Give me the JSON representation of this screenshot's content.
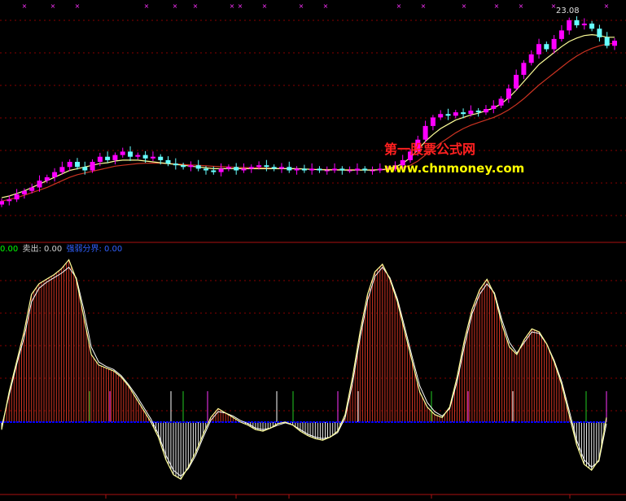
{
  "price_panel": {
    "high_label": "23.08",
    "watermark_cn": "第一股票公式网",
    "watermark_url": "www.chnmoney.com"
  },
  "indicator_panel": {
    "legend": [
      {
        "text": "0.00",
        "color": "#00ff00"
      },
      {
        "text": "卖出: 0.00",
        "color": "#d0d0d0"
      },
      {
        "text": "强弱分界: 0.00",
        "color": "#3060ff"
      }
    ]
  },
  "colors": {
    "up_candle": "#ff00ff",
    "down_candle": "#66ffff",
    "ma_fast": "#ffff99",
    "ma_slow": "#cc3322",
    "osc_line": "#ffff99",
    "osc_bars": "#cc3322",
    "zero_line": "#0000ff",
    "grid": "#880000"
  },
  "chart_data": [
    {
      "type": "candlestick",
      "title": "",
      "close": [
        12.2,
        12.3,
        12.6,
        12.8,
        13.0,
        13.4,
        13.6,
        13.9,
        14.2,
        14.5,
        14.2,
        14.0,
        14.5,
        14.8,
        14.6,
        14.9,
        15.1,
        14.8,
        14.9,
        14.7,
        14.8,
        14.6,
        14.4,
        14.3,
        14.2,
        14.3,
        14.1,
        14.0,
        13.9,
        14.1,
        14.2,
        14.0,
        14.1,
        14.2,
        14.3,
        14.2,
        14.1,
        14.2,
        14.0,
        14.1,
        14.0,
        14.1,
        14.0,
        14.0,
        14.1,
        14.0,
        14.0,
        14.1,
        14.0,
        14.0,
        14.1,
        14.1,
        14.3,
        14.6,
        15.1,
        15.8,
        16.6,
        17.1,
        17.3,
        17.2,
        17.4,
        17.3,
        17.5,
        17.4,
        17.6,
        17.8,
        18.2,
        18.8,
        19.6,
        20.3,
        20.8,
        21.4,
        21.1,
        21.7,
        22.2,
        22.8,
        22.5,
        22.6,
        22.3,
        21.8,
        21.3,
        21.6
      ],
      "ma_fast": [
        12.4,
        12.5,
        12.65,
        12.8,
        13.0,
        13.2,
        13.4,
        13.6,
        13.8,
        14.0,
        14.1,
        14.2,
        14.3,
        14.4,
        14.45,
        14.55,
        14.6,
        14.6,
        14.6,
        14.55,
        14.5,
        14.45,
        14.4,
        14.35,
        14.3,
        14.25,
        14.2,
        14.15,
        14.1,
        14.1,
        14.1,
        14.1,
        14.1,
        14.1,
        14.1,
        14.1,
        14.1,
        14.1,
        14.1,
        14.1,
        14.08,
        14.06,
        14.04,
        14.03,
        14.03,
        14.02,
        14.02,
        14.02,
        14.02,
        14.02,
        14.04,
        14.08,
        14.2,
        14.4,
        14.75,
        15.2,
        15.7,
        16.1,
        16.45,
        16.7,
        16.95,
        17.1,
        17.25,
        17.35,
        17.5,
        17.65,
        17.9,
        18.25,
        18.7,
        19.2,
        19.7,
        20.2,
        20.55,
        20.9,
        21.25,
        21.55,
        21.75,
        21.9,
        21.95,
        21.9,
        21.8,
        21.8
      ],
      "ma_slow": [
        12.2,
        12.3,
        12.4,
        12.55,
        12.7,
        12.85,
        13.0,
        13.2,
        13.4,
        13.6,
        13.75,
        13.85,
        13.95,
        14.05,
        14.15,
        14.25,
        14.3,
        14.35,
        14.4,
        14.42,
        14.43,
        14.42,
        14.4,
        14.38,
        14.35,
        14.32,
        14.3,
        14.27,
        14.24,
        14.22,
        14.2,
        14.18,
        14.17,
        14.16,
        14.15,
        14.14,
        14.13,
        14.12,
        14.1,
        14.09,
        14.08,
        14.07,
        14.06,
        14.05,
        14.05,
        14.04,
        14.04,
        14.03,
        14.03,
        14.03,
        14.03,
        14.04,
        14.08,
        14.15,
        14.3,
        14.55,
        14.9,
        15.25,
        15.6,
        15.9,
        16.2,
        16.45,
        16.65,
        16.8,
        16.95,
        17.1,
        17.3,
        17.55,
        17.85,
        18.2,
        18.6,
        19.0,
        19.35,
        19.7,
        20.05,
        20.4,
        20.7,
        20.95,
        21.15,
        21.3,
        21.4,
        21.45
      ],
      "ylim": [
        11.5,
        23.6
      ]
    },
    {
      "type": "oscillator",
      "title": "",
      "values": [
        -0.5,
        2.0,
        4.0,
        6.0,
        8.5,
        9.2,
        9.5,
        9.8,
        10.2,
        10.8,
        9.5,
        7.0,
        4.5,
        3.8,
        3.6,
        3.4,
        3.0,
        2.4,
        1.6,
        0.8,
        0,
        -1.0,
        -2.5,
        -3.5,
        -3.8,
        -3.0,
        -2.0,
        -0.8,
        0.3,
        0.9,
        0.6,
        0.3,
        0,
        -0.2,
        -0.5,
        -0.6,
        -0.4,
        -0.1,
        0,
        -0.2,
        -0.6,
        -0.9,
        -1.1,
        -1.2,
        -1.0,
        -0.6,
        0.5,
        3.0,
        6.0,
        8.5,
        10.0,
        10.5,
        9.5,
        8.0,
        6.0,
        4.0,
        2.0,
        1.0,
        0.5,
        0.3,
        1.0,
        3.0,
        5.5,
        7.5,
        8.8,
        9.5,
        8.5,
        6.5,
        5.0,
        4.5,
        5.5,
        6.2,
        6.0,
        5.2,
        4.0,
        2.5,
        0.5,
        -1.5,
        -2.8,
        -3.2,
        -2.5,
        0.3
      ],
      "signal": [
        -0.3,
        1.8,
        3.8,
        5.6,
        8.0,
        8.9,
        9.3,
        9.6,
        9.9,
        10.3,
        9.6,
        7.5,
        5.0,
        4.0,
        3.7,
        3.5,
        3.1,
        2.5,
        1.8,
        1.0,
        0.2,
        -0.8,
        -2.2,
        -3.2,
        -3.6,
        -3.1,
        -2.2,
        -1.0,
        0.1,
        0.7,
        0.6,
        0.4,
        0.1,
        -0.1,
        -0.4,
        -0.5,
        -0.4,
        -0.2,
        -0.05,
        -0.2,
        -0.5,
        -0.8,
        -1.0,
        -1.1,
        -1.0,
        -0.7,
        0.3,
        2.6,
        5.6,
        8.1,
        9.7,
        10.3,
        9.6,
        8.2,
        6.3,
        4.3,
        2.4,
        1.3,
        0.7,
        0.4,
        0.9,
        2.7,
        5.1,
        7.2,
        8.5,
        9.2,
        8.6,
        6.8,
        5.3,
        4.6,
        5.3,
        6.0,
        5.9,
        5.2,
        4.1,
        2.7,
        0.8,
        -1.2,
        -2.5,
        -3.0,
        -2.6,
        -0.1
      ],
      "ylim": [
        -4.6,
        11.2
      ]
    }
  ]
}
